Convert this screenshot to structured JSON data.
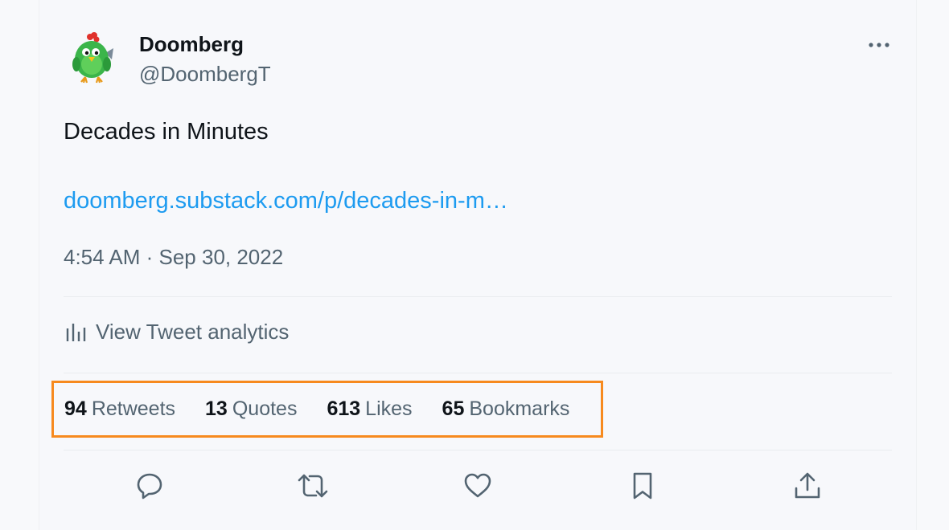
{
  "author": {
    "name": "Doomberg",
    "handle": "@DoombergT",
    "avatar_icon": "green-chicken-avatar"
  },
  "more_icon": "ellipsis-icon",
  "tweet": {
    "text": "Decades in Minutes",
    "link": "doomberg.substack.com/p/decades-in-m…",
    "timestamp": "4:54 AM · Sep 30, 2022"
  },
  "analytics": {
    "label": "View Tweet analytics",
    "icon": "bar-chart-icon"
  },
  "stats": [
    {
      "count": "94",
      "label": "Retweets"
    },
    {
      "count": "13",
      "label": "Quotes"
    },
    {
      "count": "613",
      "label": "Likes"
    },
    {
      "count": "65",
      "label": "Bookmarks"
    }
  ],
  "highlight_color": "#f78a1e",
  "colors": {
    "text_primary": "#0f1419",
    "text_secondary": "#536471",
    "link": "#1d9bf0"
  },
  "actions": [
    "reply-icon",
    "retweet-icon",
    "like-icon",
    "bookmark-icon",
    "share-icon"
  ]
}
